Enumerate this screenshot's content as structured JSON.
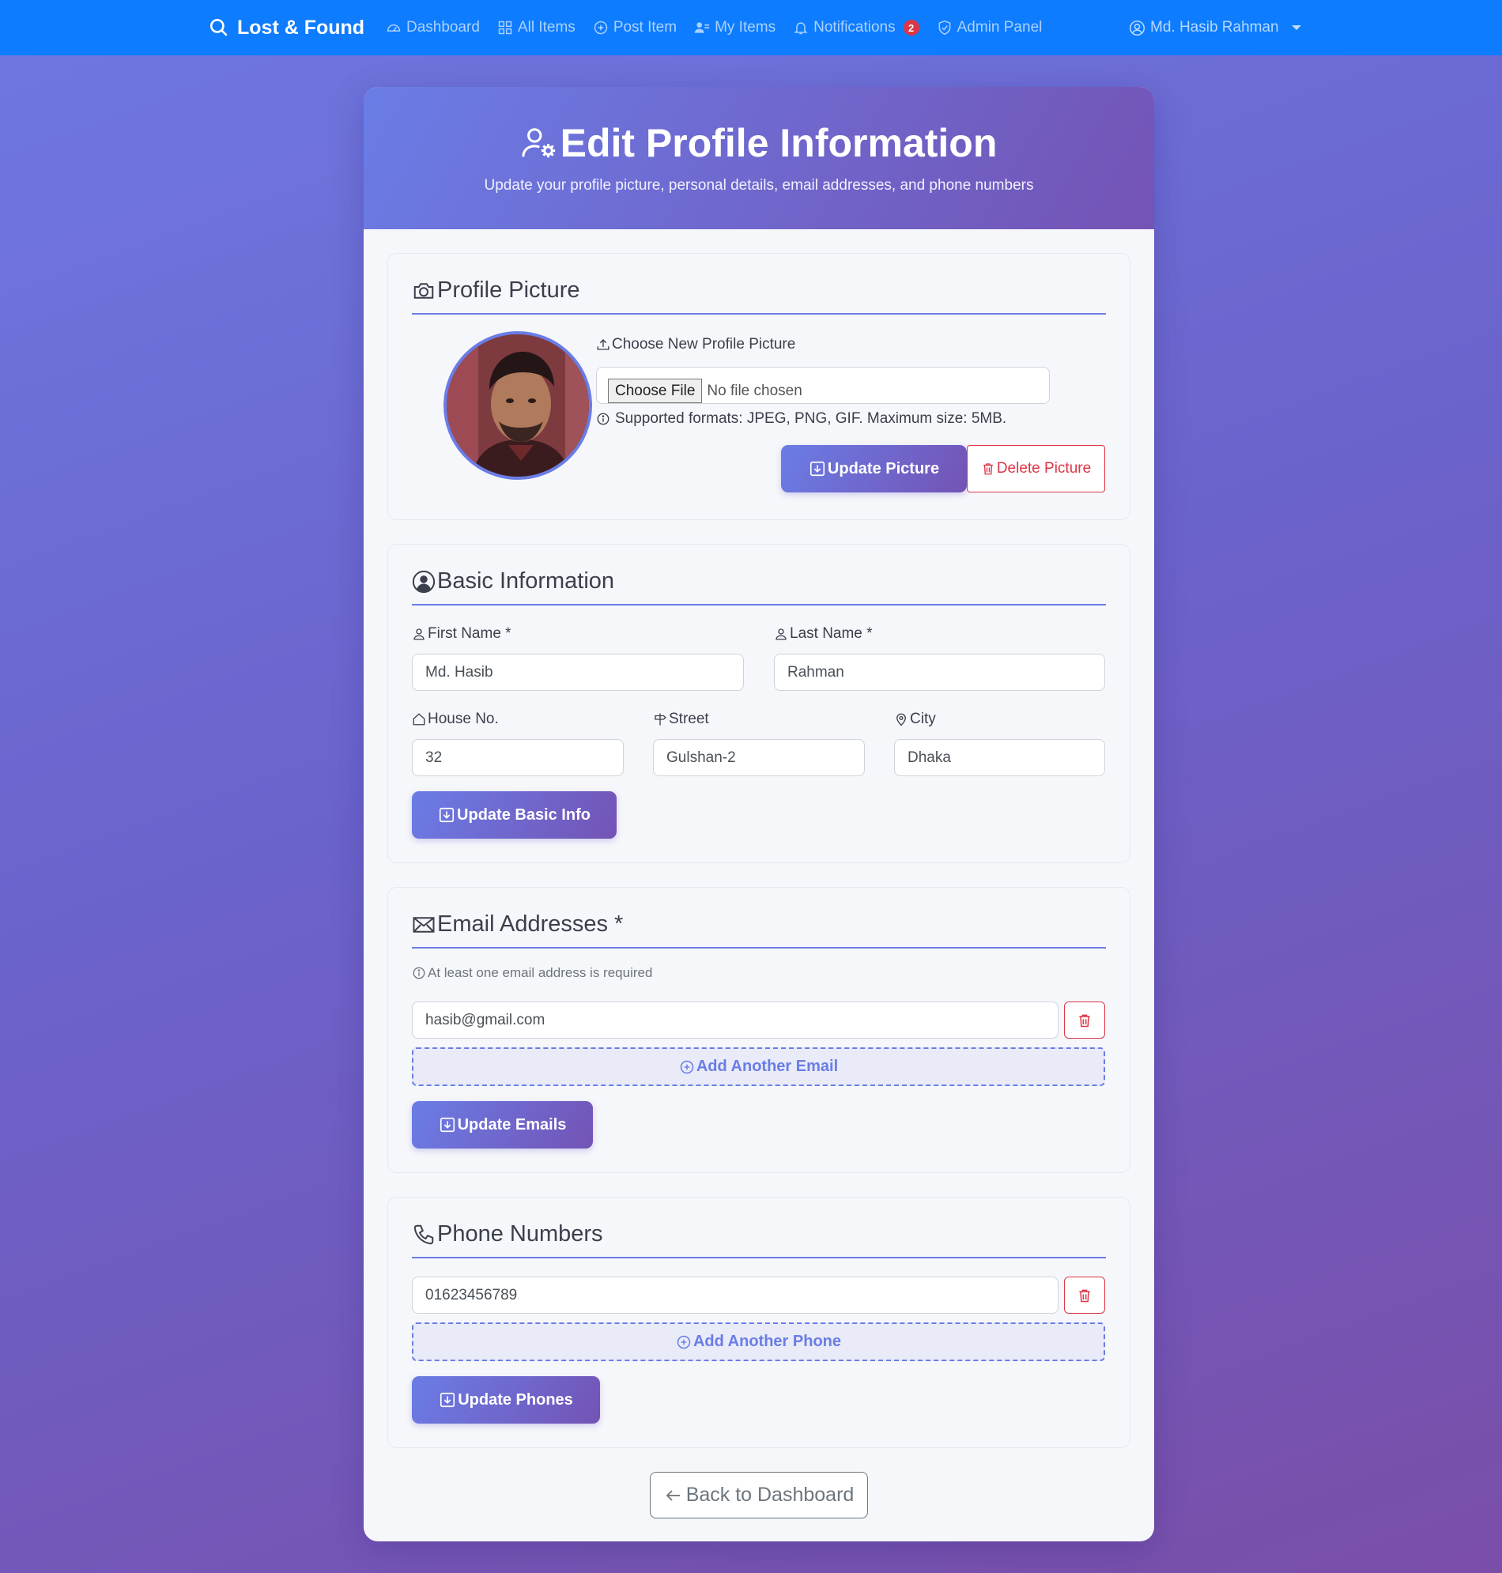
{
  "nav": {
    "brand": "Lost & Found",
    "links": [
      {
        "label": "Dashboard"
      },
      {
        "label": "All Items"
      },
      {
        "label": "Post Item"
      },
      {
        "label": "My Items"
      },
      {
        "label": "Notifications",
        "badge": "2"
      },
      {
        "label": "Admin Panel"
      }
    ],
    "user": "Md. Hasib Rahman"
  },
  "header": {
    "title": "Edit Profile Information",
    "subtitle": "Update your profile picture, personal details, email addresses, and phone numbers"
  },
  "picture": {
    "title": "Profile Picture",
    "choose_label": "Choose New Profile Picture",
    "file_button": "Choose File",
    "file_status": "No file chosen",
    "help": "Supported formats: JPEG, PNG, GIF. Maximum size: 5MB.",
    "update_btn": "Update Picture",
    "delete_btn": "Delete Picture"
  },
  "basic": {
    "title": "Basic Information",
    "first_name_label": "First Name *",
    "first_name": "Md. Hasib",
    "last_name_label": "Last Name *",
    "last_name": "Rahman",
    "house_label": "House No.",
    "house": "32",
    "street_label": "Street",
    "street": "Gulshan-2",
    "city_label": "City",
    "city": "Dhaka",
    "update_btn": "Update Basic Info"
  },
  "email": {
    "title": "Email Addresses *",
    "note": "At least one email address is required",
    "value": "hasib@gmail.com",
    "add_btn": "Add Another Email",
    "update_btn": "Update Emails"
  },
  "phone": {
    "title": "Phone Numbers",
    "value": "01623456789",
    "add_btn": "Add Another Phone",
    "update_btn": "Update Phones"
  },
  "back_btn": "Back to Dashboard",
  "colors": {
    "navbar": "#0d7cff",
    "accent": "#6a7de6",
    "accent_dark": "#7453b5",
    "danger": "#dc3545"
  }
}
